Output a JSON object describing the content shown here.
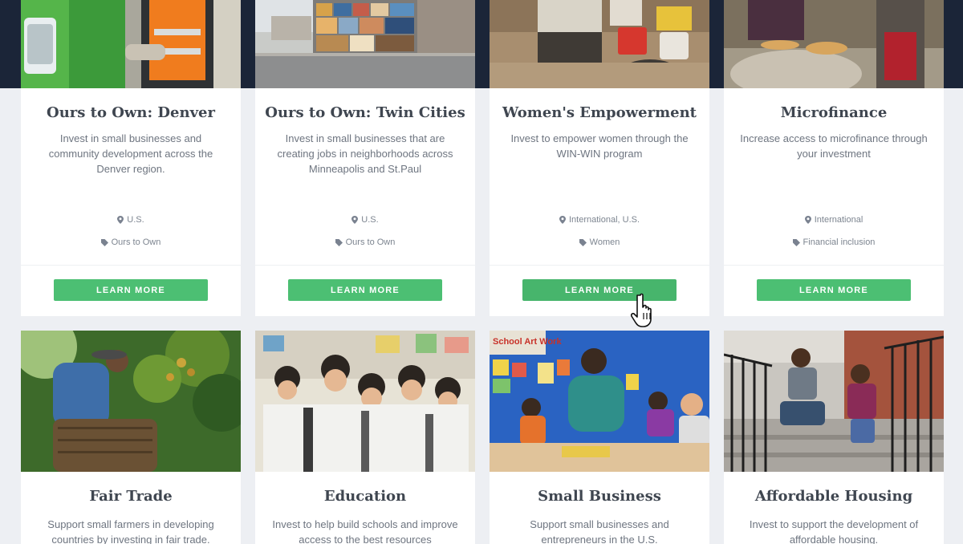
{
  "cards_row1": [
    {
      "title": "Ours to Own: Denver",
      "description": "Invest in small businesses and community development across the Denver region.",
      "location": "U.S.",
      "tag": "Ours to Own",
      "button": "LEARN MORE"
    },
    {
      "title": "Ours to Own: Twin Cities",
      "description": "Invest in small businesses that are creating jobs in neighborhoods across Minneapolis and St.Paul",
      "location": "U.S.",
      "tag": "Ours to Own",
      "button": "LEARN MORE"
    },
    {
      "title": "Women's Empowerment",
      "description": "Invest to empower women through the WIN-WIN program",
      "location": "International, U.S.",
      "tag": "Women",
      "button": "LEARN MORE"
    },
    {
      "title": "Microfinance",
      "description": "Increase access to microfinance through your investment",
      "location": "International",
      "tag": "Financial inclusion",
      "button": "LEARN MORE"
    }
  ],
  "cards_row2": [
    {
      "title": "Fair Trade",
      "description": "Support small farmers in developing countries by investing in fair trade."
    },
    {
      "title": "Education",
      "description": "Invest to help build schools and improve access to the best resources"
    },
    {
      "title": "Small Business",
      "description": "Support small businesses and entrepreneurs in the U.S."
    },
    {
      "title": "Affordable Housing",
      "description": "Invest to support the development of affordable housing."
    }
  ],
  "photos_row2": {
    "classroom_sign": "School Art Work"
  },
  "colors": {
    "button_green": "#4cbf73",
    "dark_band": "#1b2538",
    "page_bg": "#edeff3",
    "title_text": "#3f4650",
    "body_text": "#6e7580"
  },
  "icons": {
    "location": "map-pin-icon",
    "tag": "tag-icon",
    "cursor": "hand-pointer-icon"
  }
}
